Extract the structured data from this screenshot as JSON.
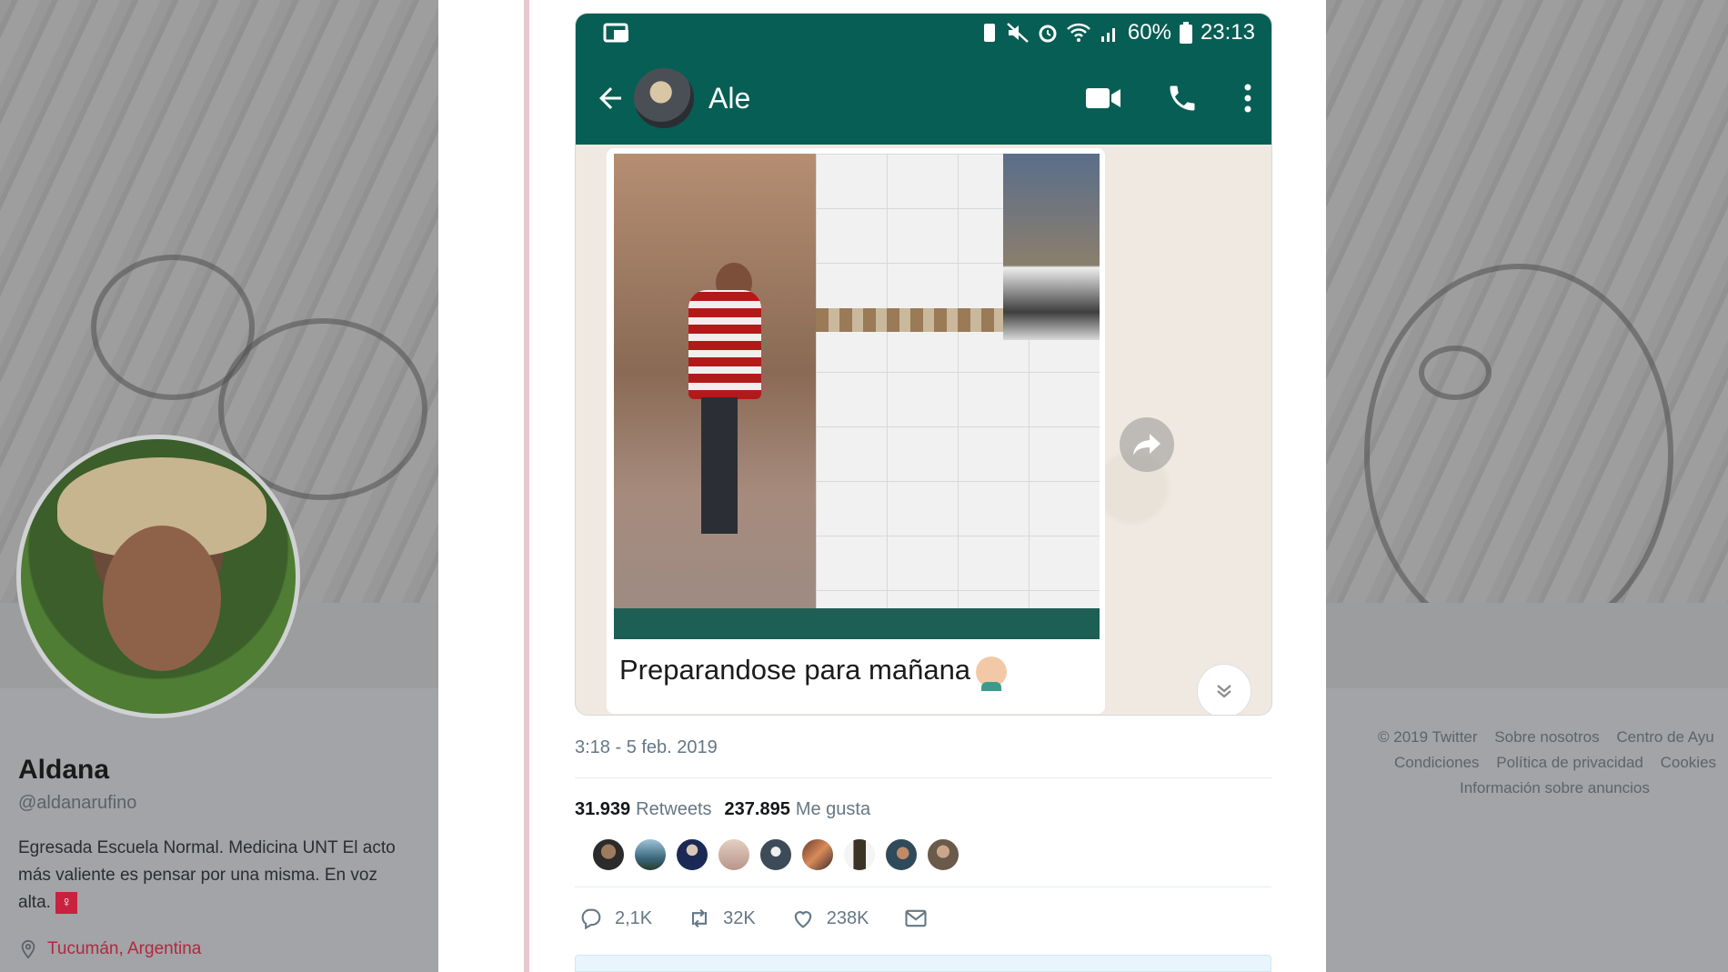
{
  "profile": {
    "name": "Aldana",
    "handle": "@aldanarufino",
    "bio": "Egresada Escuela Normal. Medicina UNT El acto más valiente es pensar por una misma. En voz alta.",
    "bio_badge": "♀",
    "location": "Tucumán, Argentina"
  },
  "footer": {
    "row1": [
      "© 2019 Twitter",
      "Sobre nosotros",
      "Centro de Ayu"
    ],
    "row2": [
      "Condiciones",
      "Política de privacidad",
      "Cookies"
    ],
    "row3": [
      "Información sobre anuncios"
    ]
  },
  "phone": {
    "battery": "60%",
    "time": "23:13",
    "contact_name": "Ale",
    "caption": "Preparandose para mañana"
  },
  "tweet": {
    "timestamp": "3:18 - 5 feb. 2019",
    "retweets_count": "31.939",
    "retweets_label": "Retweets",
    "likes_count": "237.895",
    "likes_label": "Me gusta",
    "reply_count": "2,1K",
    "retweet_count_short": "32K",
    "like_count_short": "238K"
  },
  "colors": {
    "whatsapp_green": "#075e54",
    "twitter_gray": "#657786",
    "location_red": "#b0283f"
  }
}
